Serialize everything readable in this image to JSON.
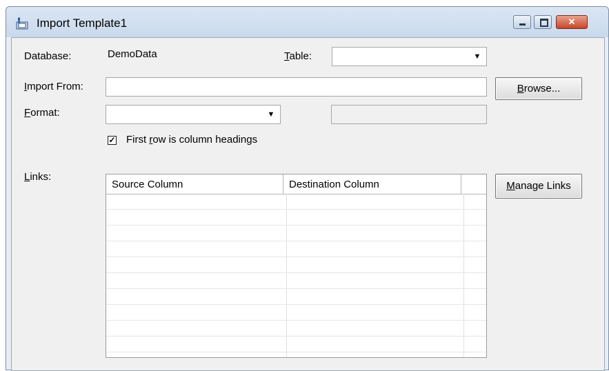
{
  "window": {
    "title": "Import Template1",
    "close_glyph": "✕"
  },
  "form": {
    "database_label": "Database:",
    "database_value": "DemoData",
    "table_label_accel": "T",
    "table_label_rest": "able:",
    "table_value": "",
    "import_from_label_accel": "I",
    "import_from_label_rest": "mport From:",
    "import_from_value": "",
    "browse_accel": "B",
    "browse_rest": "rowse...",
    "format_label_accel": "F",
    "format_label_rest": "ormat:",
    "format_value": "",
    "format_detail_value": "",
    "first_row_prefix": "First ",
    "first_row_accel": "r",
    "first_row_rest": "ow is column headings",
    "first_row_checked": true,
    "check_glyph": "✓",
    "links_label_accel": "L",
    "links_label_rest": "inks:",
    "manage_links_accel": "M",
    "manage_links_rest": "anage Links"
  },
  "links_grid": {
    "columns": [
      "Source Column",
      "Destination Column",
      ""
    ],
    "rows": [
      [
        "",
        "",
        ""
      ],
      [
        "",
        "",
        ""
      ],
      [
        "",
        "",
        ""
      ],
      [
        "",
        "",
        ""
      ],
      [
        "",
        "",
        ""
      ],
      [
        "",
        "",
        ""
      ],
      [
        "",
        "",
        ""
      ],
      [
        "",
        "",
        ""
      ],
      [
        "",
        "",
        ""
      ],
      [
        "",
        "",
        ""
      ]
    ]
  },
  "icons": {
    "app": "import-template-icon",
    "minimize": "minimize-icon",
    "maximize": "maximize-icon",
    "close": "close-icon",
    "dropdown": "chevron-down-icon"
  }
}
